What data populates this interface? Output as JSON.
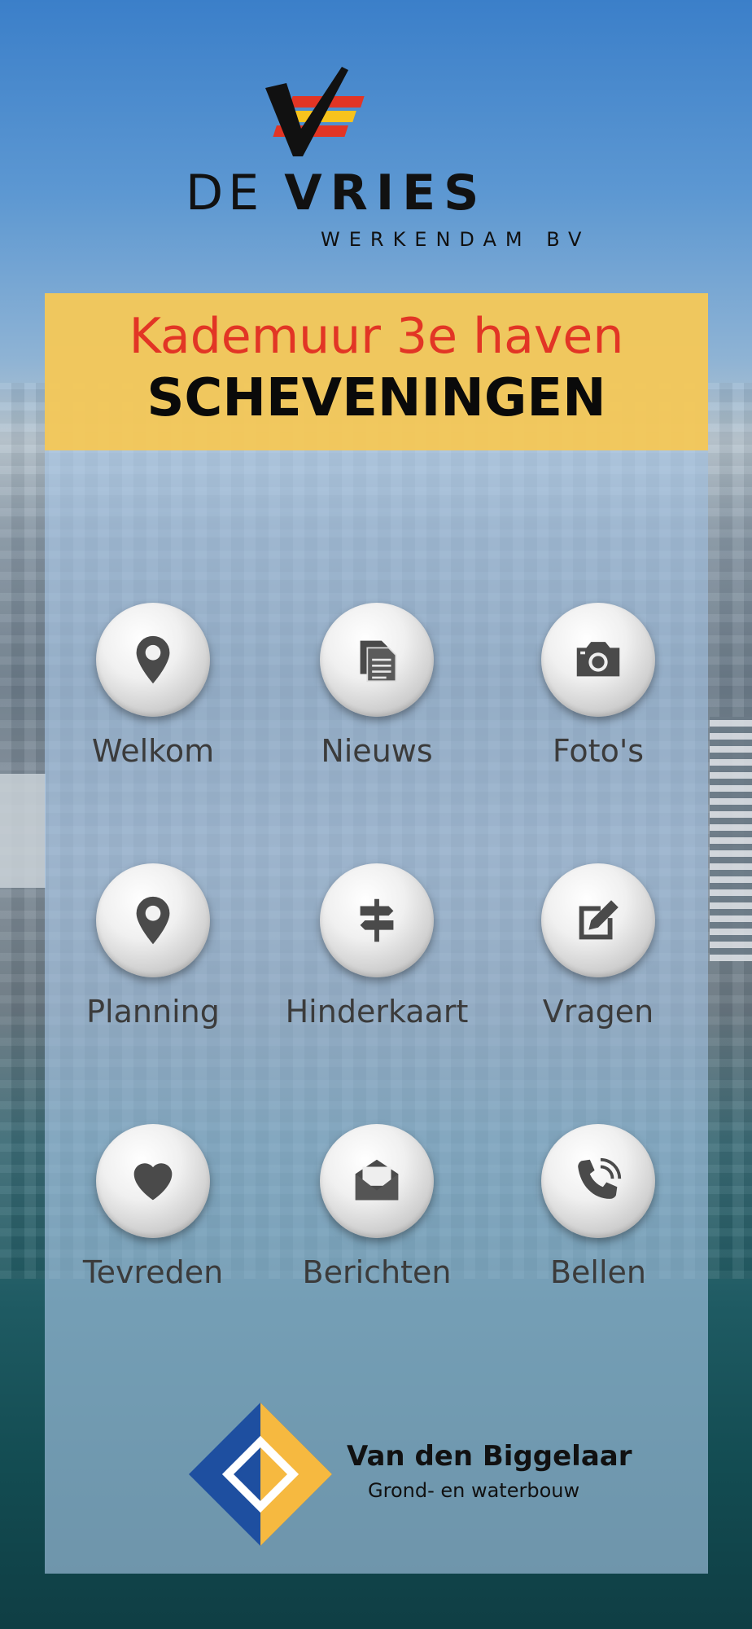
{
  "brand": {
    "name_light": "DE",
    "name_bold": "VRIES",
    "subtitle": "WERKENDAM BV",
    "colors": {
      "red": "#e23525",
      "yellow": "#f7c31d",
      "black": "#111111"
    }
  },
  "header": {
    "title_line1": "Kademuur 3e haven",
    "title_line2": "SCHEVENINGEN",
    "band_color": "#f8c850"
  },
  "menu": [
    {
      "label": "Welkom",
      "icon": "location-pin-icon"
    },
    {
      "label": "Nieuws",
      "icon": "documents-icon"
    },
    {
      "label": "Foto's",
      "icon": "camera-icon"
    },
    {
      "label": "Planning",
      "icon": "location-pin-icon"
    },
    {
      "label": "Hinderkaart",
      "icon": "signpost-icon"
    },
    {
      "label": "Vragen",
      "icon": "edit-icon"
    },
    {
      "label": "Tevreden",
      "icon": "heart-icon"
    },
    {
      "label": "Berichten",
      "icon": "mail-icon"
    },
    {
      "label": "Bellen",
      "icon": "phone-icon"
    }
  ],
  "partner": {
    "name": "Van den Biggelaar",
    "tagline": "Grond- en waterbouw",
    "colors": {
      "blue": "#1e4fa0",
      "yellow": "#f6b940"
    }
  }
}
